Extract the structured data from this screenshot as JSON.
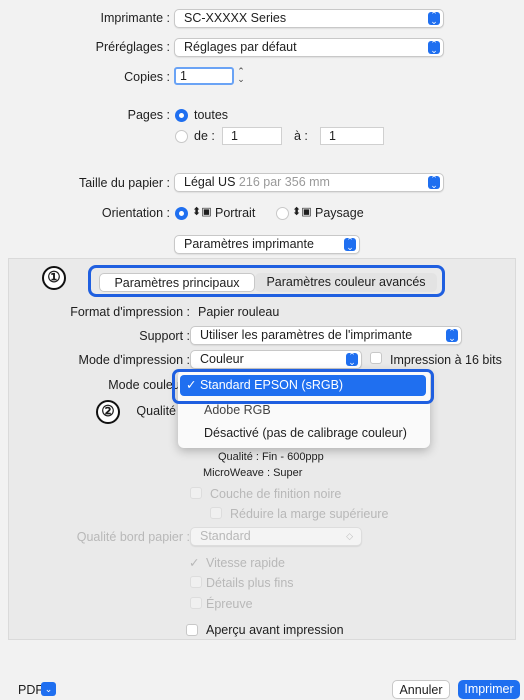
{
  "printer": {
    "label": "Imprimante :",
    "value": "SC-XXXXX Series"
  },
  "presets": {
    "label": "Préréglages :",
    "value": "Réglages par défaut"
  },
  "copies": {
    "label": "Copies :",
    "value": "1"
  },
  "pages": {
    "label": "Pages :",
    "all_label": "toutes",
    "from_label": "de :",
    "from_value": "1",
    "to_label": "à :",
    "to_value": "1"
  },
  "paper_size": {
    "label": "Taille du papier :",
    "value": "Légal US",
    "detail": "216 par 356 mm"
  },
  "orientation": {
    "label": "Orientation :",
    "portrait": "Portrait",
    "landscape": "Paysage"
  },
  "section_popup": {
    "value": "Paramètres imprimante"
  },
  "tabs": [
    {
      "label": "Paramètres principaux",
      "selected": true
    },
    {
      "label": "Paramètres couleur avancés",
      "selected": false
    }
  ],
  "callouts": [
    "①",
    "②"
  ],
  "settings": {
    "print_format": {
      "label": "Format d'impression :",
      "value": "Papier rouleau"
    },
    "support": {
      "label": "Support :",
      "value": "Utiliser les paramètres de l'imprimante"
    },
    "print_mode": {
      "label": "Mode d'impression :",
      "value": "Couleur",
      "bit16_label": "Impression à 16 bits"
    },
    "color_mode": {
      "label": "Mode couleur"
    },
    "quality": {
      "label": "Qualité"
    },
    "quality_info": "Qualité : Fin - 600ppp",
    "microweave": "MicroWeave : Super",
    "black_finish": "Couche de finition noire",
    "reduce_margin": "Réduire la marge supérieure",
    "paper_edge_quality": {
      "label": "Qualité bord papier :",
      "value": "Standard"
    },
    "high_speed": "Vitesse rapide",
    "finer_details": "Détails plus fins",
    "proof": "Épreuve",
    "preview": "Aperçu avant impression"
  },
  "color_mode_menu": {
    "items": [
      {
        "label": "Standard EPSON (sRGB)",
        "selected": true
      },
      {
        "label": "Adobe RGB",
        "selected": false
      },
      {
        "label": "Désactivé (pas de calibrage couleur)",
        "selected": false
      }
    ]
  },
  "footer": {
    "pdf_label": "PDF",
    "cancel": "Annuler",
    "print": "Imprimer"
  },
  "colors": {
    "accent": "#1f6ff0",
    "callout_border": "#1f5fe0"
  }
}
